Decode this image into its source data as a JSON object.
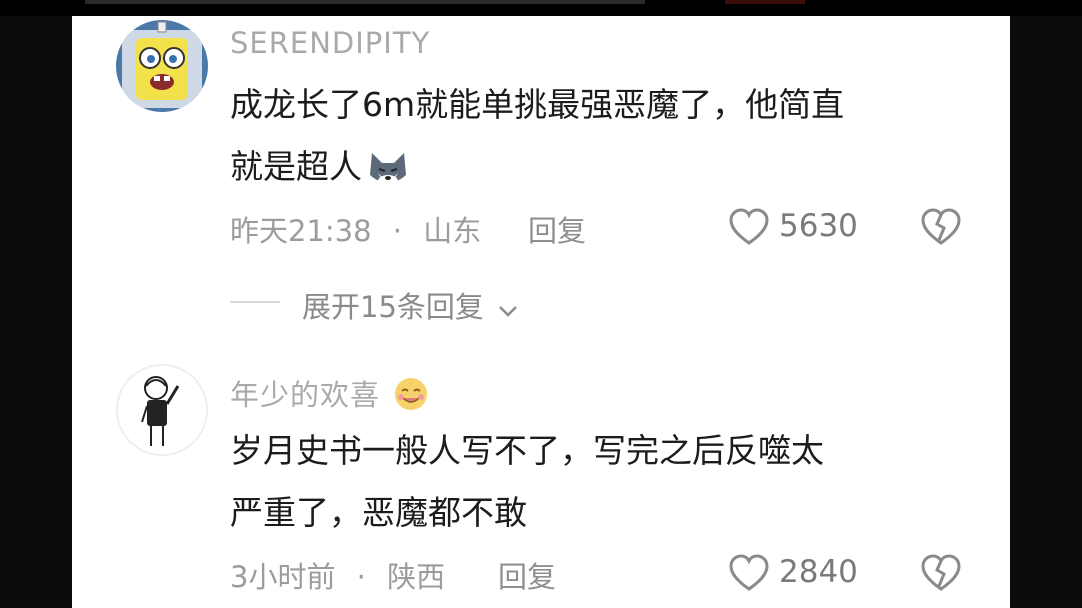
{
  "comments": [
    {
      "username": "SERENDIPITY",
      "text_line1": "成龙长了6m就能单挑最强恶魔了，他简直",
      "text_line2": "就是超人",
      "time": "昨天21:38",
      "location": "山东",
      "separator": "·",
      "reply_label": "回复",
      "likes": "5630",
      "avatar_icon": "cartoon-avatar-icon",
      "inline_emoji": "wolf-emoji-icon"
    },
    {
      "username": "年少的欢喜",
      "text_line1": "岁月史书一般人写不了，写完之后反噬太",
      "text_line2": "严重了，恶魔都不敢",
      "time": "3小时前",
      "location": "陕西",
      "separator": "·",
      "reply_label": "回复",
      "likes": "2840",
      "avatar_icon": "sketch-person-avatar-icon",
      "name_emoji": "smile-emoji-icon"
    }
  ],
  "expand_replies": {
    "label": "展开15条回复"
  },
  "colors": {
    "background": "#ffffff",
    "text": "#1c1c1c",
    "muted": "#9c9c9c"
  }
}
